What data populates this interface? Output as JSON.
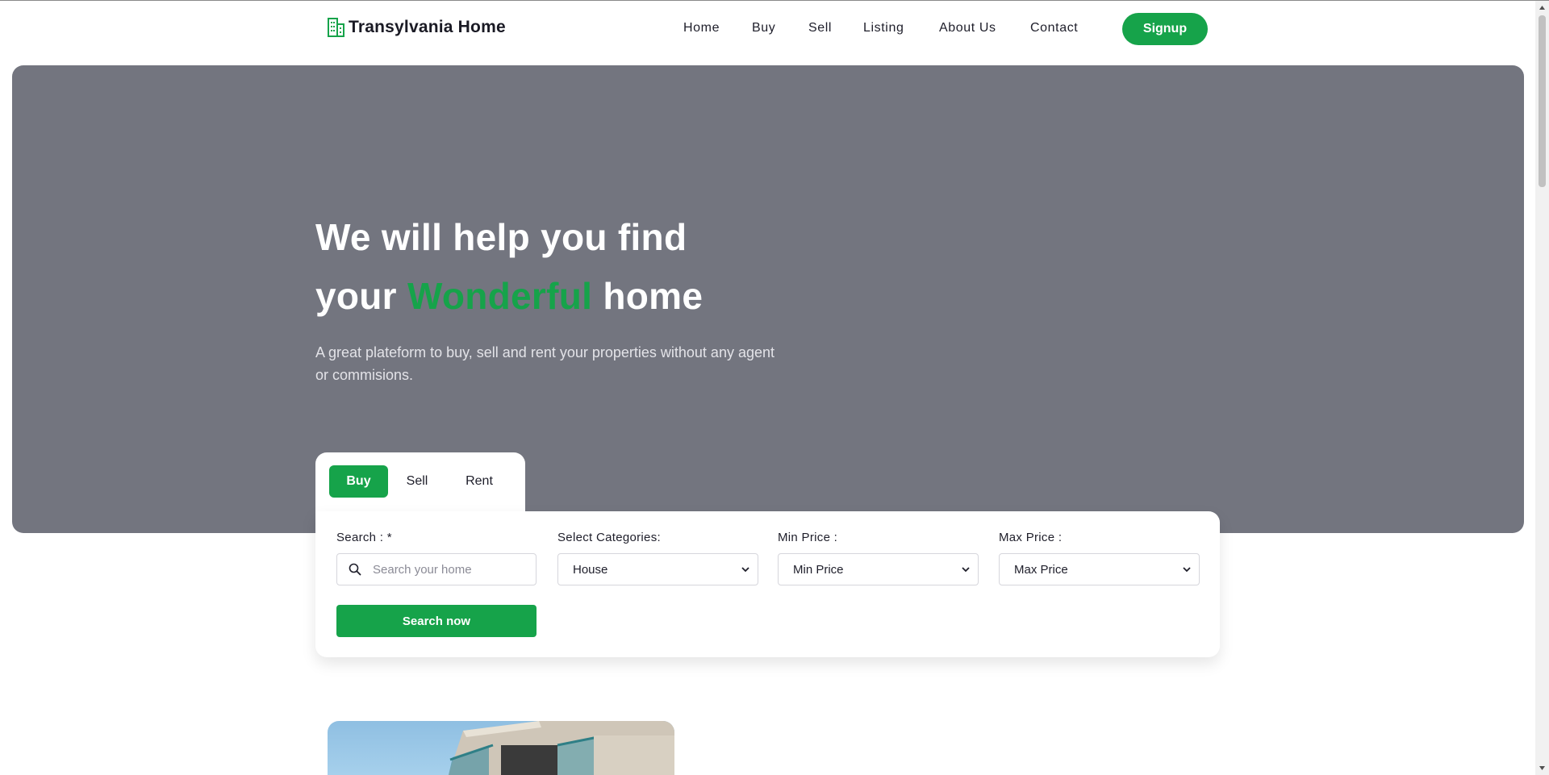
{
  "header": {
    "logo_text": "Transylvania Home",
    "nav": [
      "Home",
      "Buy",
      "Sell",
      "Listing",
      "About Us",
      "Contact"
    ],
    "signup_label": "Signup"
  },
  "hero": {
    "title_line1": "We will help you find",
    "title_line2_pre": "your ",
    "title_line2_highlight": "Wonderful",
    "title_line2_post": " home",
    "subtitle": "A great plateform to buy, sell and rent your properties without any agent or commisions."
  },
  "search": {
    "tabs": [
      "Buy",
      "Sell",
      "Rent"
    ],
    "active_tab": "Buy",
    "search_label": "Search : *",
    "search_placeholder": "Search your home",
    "categories_label": "Select Categories:",
    "categories_value": "House",
    "min_price_label": "Min Price :",
    "min_price_value": "Min Price",
    "max_price_label": "Max Price :",
    "max_price_value": "Max Price",
    "button_label": "Search now"
  },
  "colors": {
    "accent": "#16a34a",
    "hero_bg": "#73757f"
  },
  "icons": {
    "logo": "building-icon",
    "search": "search-icon",
    "select": "chevron-down-icon"
  }
}
